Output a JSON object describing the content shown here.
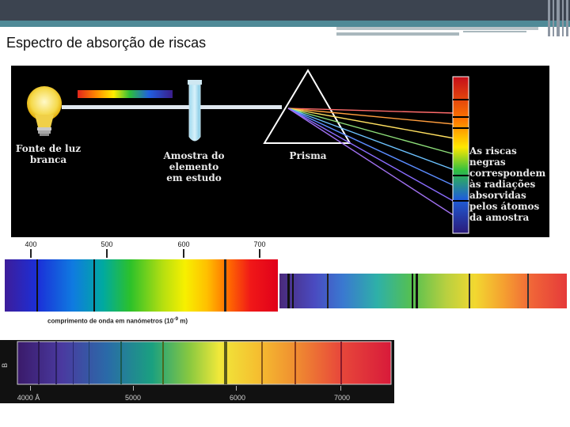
{
  "title": "Espectro de absorção de riscas",
  "diagram": {
    "light_source_label": [
      "Fonte de luz",
      "branca"
    ],
    "sample_label": [
      "Amostra do",
      "elemento",
      "em estudo"
    ],
    "prism_label": "Prisma",
    "note_label": [
      "As riscas",
      "negras",
      "correspondem",
      "às radiações",
      "absorvidas",
      "pelos átomos",
      "da amostra"
    ]
  },
  "spectrum1": {
    "ticks": [
      "400",
      "500",
      "600",
      "700"
    ],
    "caption_main": "comprimento de onda em nanómetros (10",
    "caption_exp": "-9",
    "caption_unit": " m)"
  },
  "spectrum3": {
    "ticks": [
      "4000 Å",
      "5000",
      "6000",
      "7000"
    ],
    "side_mark": "B"
  },
  "colors": {
    "topbar": "#3c4450",
    "teal": "#4f8a97",
    "diagram_bg": "#000000"
  }
}
